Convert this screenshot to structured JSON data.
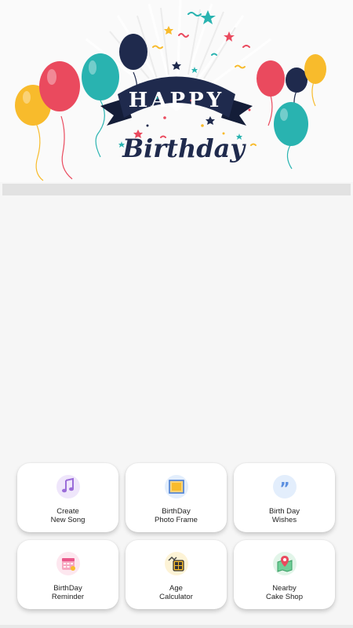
{
  "banner": {
    "line1": "HAPPY",
    "line2": "Birthday"
  },
  "menu": [
    {
      "line1": "Create",
      "line2": "New Song",
      "icon": "music-note-icon"
    },
    {
      "line1": "BirthDay",
      "line2": "Photo Frame",
      "icon": "photo-frame-icon"
    },
    {
      "line1": "Birth Day",
      "line2": "Wishes",
      "icon": "quote-icon"
    },
    {
      "line1": "BirthDay",
      "line2": "Reminder",
      "icon": "calendar-icon"
    },
    {
      "line1": "Age",
      "line2": "Calculator",
      "icon": "calculator-icon"
    },
    {
      "line1": "Nearby",
      "line2": "Cake Shop",
      "icon": "map-pin-icon"
    }
  ],
  "colors": {
    "navy": "#1f2a4d",
    "red": "#ea4a5e",
    "teal": "#29b3b0",
    "yellow": "#f8bb2c"
  }
}
